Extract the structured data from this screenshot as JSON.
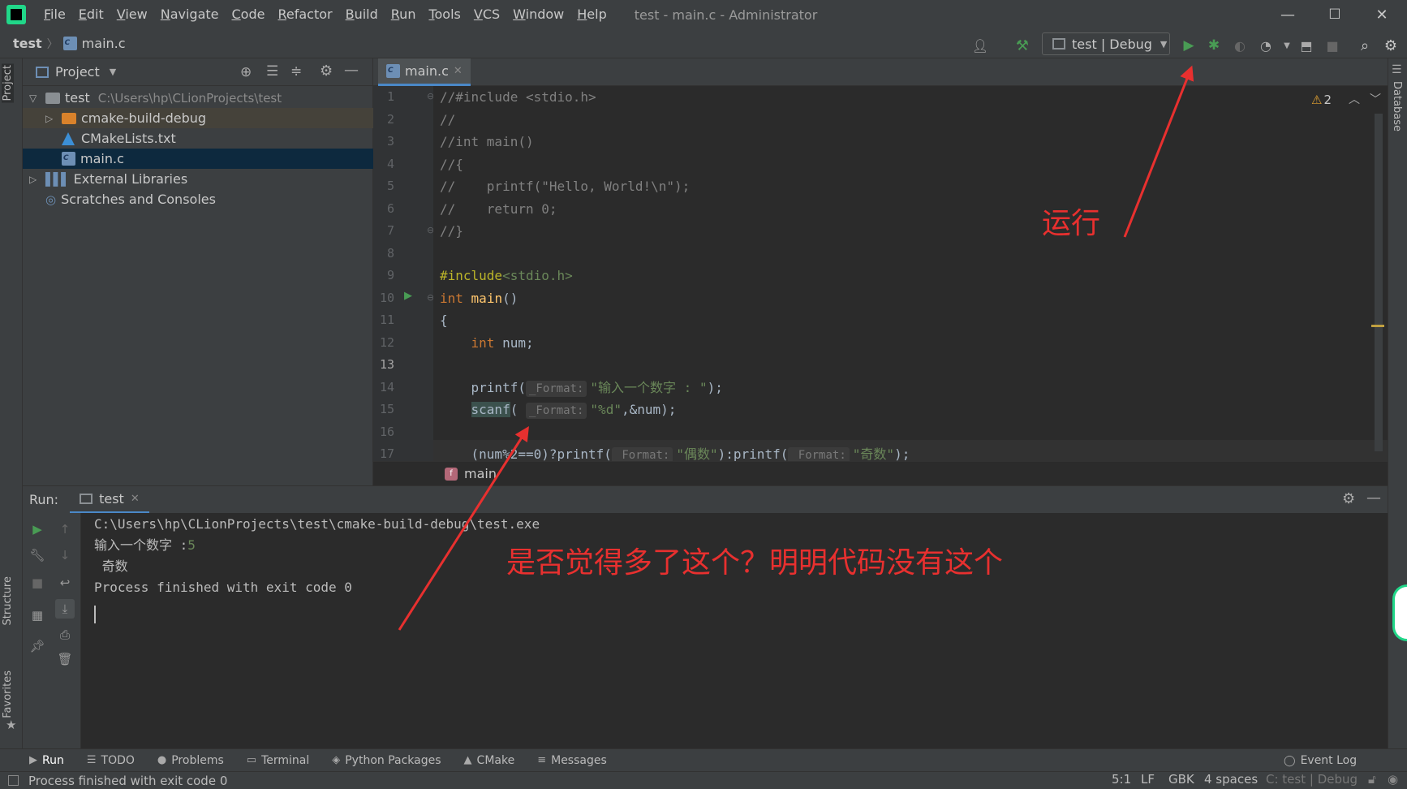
{
  "menu": [
    "File",
    "Edit",
    "View",
    "Navigate",
    "Code",
    "Refactor",
    "Build",
    "Run",
    "Tools",
    "VCS",
    "Window",
    "Help"
  ],
  "window_title": "test - main.c - Administrator",
  "window_controls": {
    "minimize": "—",
    "maximize": "☐",
    "close": "✕"
  },
  "nav": {
    "project": "test",
    "file": "main.c"
  },
  "run_config": "test | Debug",
  "project_panel": {
    "title": "Project",
    "tree": [
      {
        "name": "test",
        "path": "C:\\Users\\hp\\CLionProjects\\test"
      },
      {
        "name": "cmake-build-debug"
      },
      {
        "name": "CMakeLists.txt"
      },
      {
        "name": "main.c"
      },
      {
        "name": "External Libraries"
      },
      {
        "name": "Scratches and Consoles"
      }
    ]
  },
  "side_tabs": {
    "project": "Project",
    "structure": "Structure",
    "favorites": "Favorites",
    "database": "Database"
  },
  "editor": {
    "tab": "main.c",
    "warnings": "2",
    "line_numbers": [
      "1",
      "2",
      "3",
      "4",
      "5",
      "6",
      "7",
      "8",
      "9",
      "10",
      "11",
      "12",
      "13",
      "14",
      "15",
      "16",
      "17"
    ],
    "lines": {
      "l1": "//#include <stdio.h>",
      "l2": "//",
      "l3": "//int main()",
      "l4": "//{",
      "l5": "//    printf(\"Hello, World!\\n\");",
      "l6": "//    return 0;",
      "l7": "//}",
      "l9_pp": "#include",
      "l9_inc": "<stdio.h>",
      "l10_kw": "int",
      "l10_fn": "main",
      "l10_rest": "()",
      "l11": "{",
      "l12_kw": "int",
      "l12_rest": " num;",
      "l14_fn": "printf(",
      "l14_hint": "_Format:",
      "l14_str": "\"输入一个数字 : \"",
      "l14_end": ");",
      "l15_fn": "scanf",
      "l15_paren": "(",
      "l15_hint": "_Format:",
      "l15_str": "\"%d\"",
      "l15_end": ",&num);",
      "l17_a": "(num%2==0)?printf(",
      "l17_hint1": "_Format:",
      "l17_str1": "\"偶数\"",
      "l17_b": "):printf(",
      "l17_hint2": "_Format:",
      "l17_str2": "\"奇数\"",
      "l17_end": ");"
    },
    "breadcrumb": "main"
  },
  "run_panel": {
    "label": "Run:",
    "tab": "test",
    "console": {
      "path": "C:\\Users\\hp\\CLionProjects\\test\\cmake-build-debug\\test.exe",
      "prompt": "输入一个数字 :",
      "input": "5",
      "output": " 奇数",
      "finished": "Process finished with exit code 0"
    }
  },
  "bottom_tabs": [
    "Run",
    "TODO",
    "Problems",
    "Terminal",
    "Python Packages",
    "CMake",
    "Messages"
  ],
  "event_log": "Event Log",
  "status": {
    "message": "Process finished with exit code 0",
    "position": "5:1",
    "line_sep": "LF",
    "encoding": "GBK",
    "indent": "4 spaces",
    "context": "C: test | Debug"
  },
  "annotations": {
    "run": "运行",
    "question": "是否觉得多了这个？明明代码没有这个"
  },
  "colors": {
    "accent": "#4a88c7",
    "run_green": "#499c54",
    "annotation_red": "#e8302f"
  }
}
